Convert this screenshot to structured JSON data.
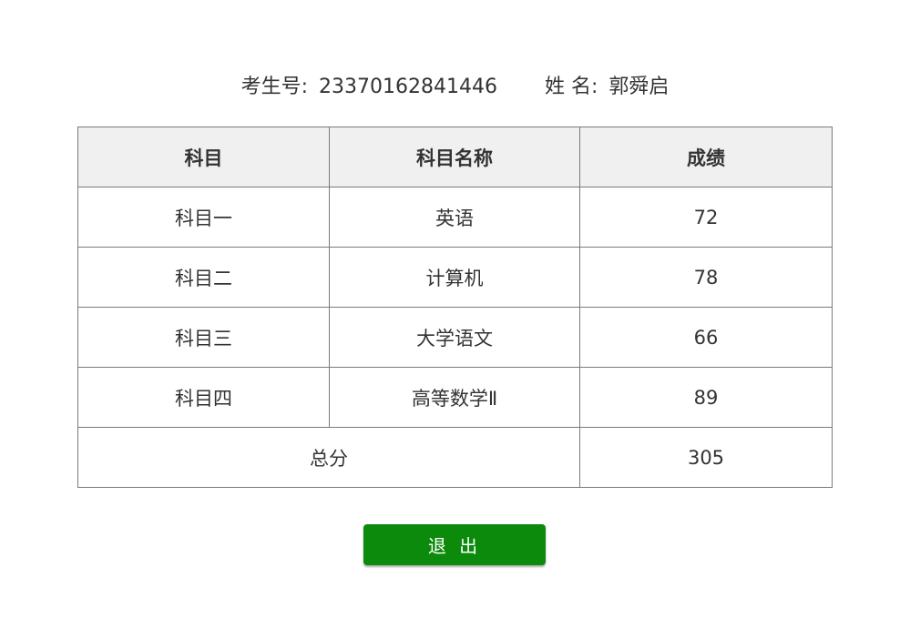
{
  "candidate": {
    "id_label": "考生号:",
    "id_value": "23370162841446",
    "name_label": "姓 名:",
    "name_value": "郭舜启"
  },
  "table": {
    "headers": [
      "科目",
      "科目名称",
      "成绩"
    ],
    "rows": [
      {
        "subject": "科目一",
        "subject_name": "英语",
        "score": "72"
      },
      {
        "subject": "科目二",
        "subject_name": "计算机",
        "score": "78"
      },
      {
        "subject": "科目三",
        "subject_name": "大学语文",
        "score": "66"
      },
      {
        "subject": "科目四",
        "subject_name": "高等数学Ⅱ",
        "score": "89"
      }
    ],
    "total_label": "总分",
    "total_value": "305"
  },
  "actions": {
    "exit_label": "退 出"
  },
  "colors": {
    "exit_button_bg": "#0b8a0b",
    "header_bg": "#f0f0f0",
    "border": "#7a7a7a",
    "text": "#333333"
  }
}
